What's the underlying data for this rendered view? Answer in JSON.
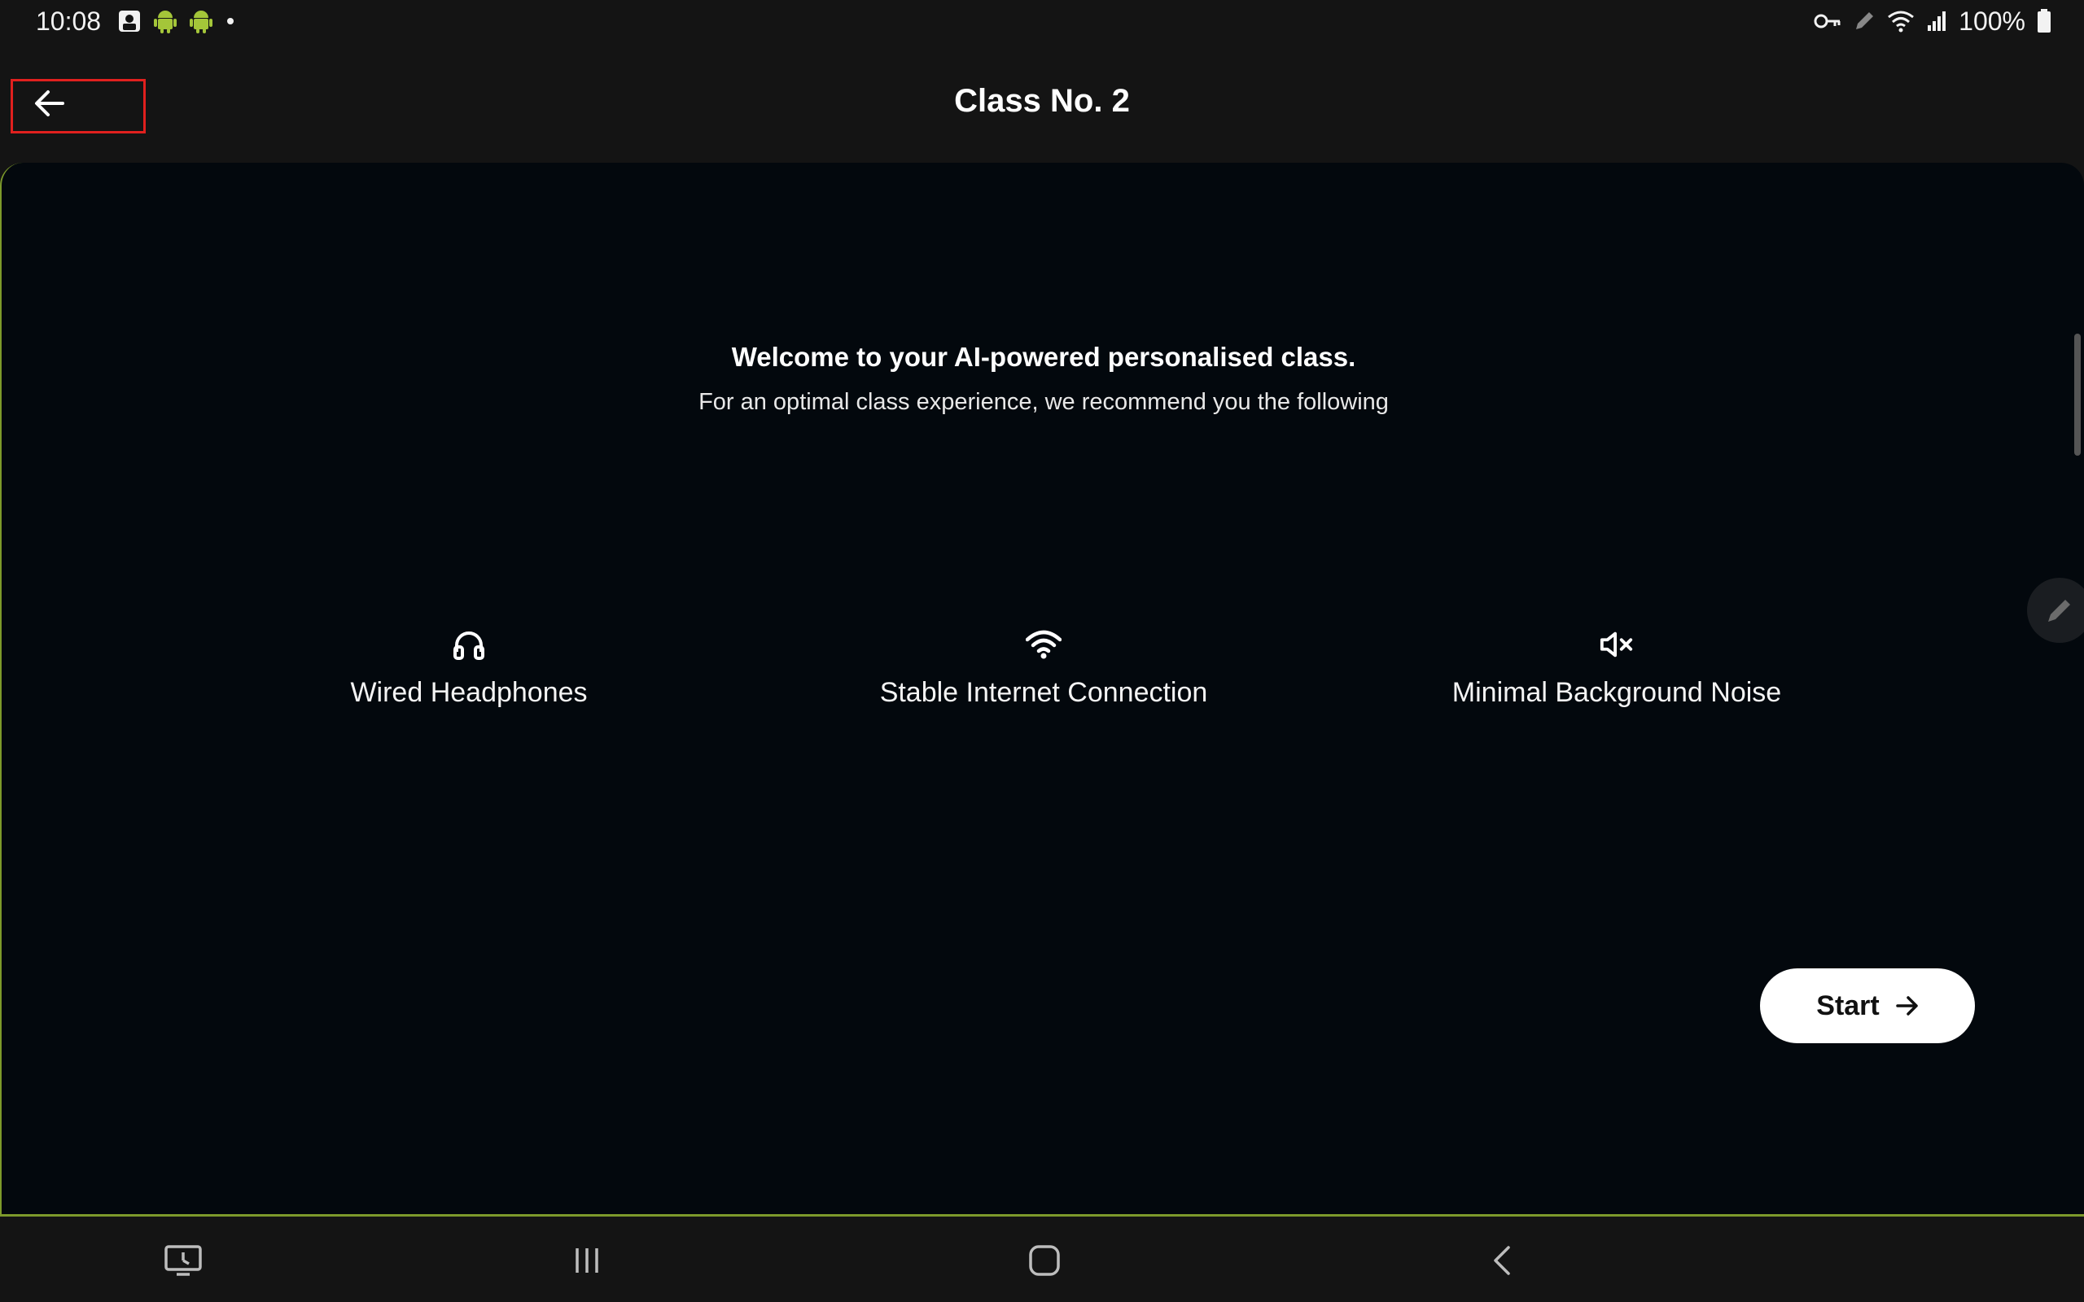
{
  "status_bar": {
    "time": "10:08",
    "battery_text": "100%",
    "left_icons": [
      "notification-icon",
      "android-icon",
      "android-icon",
      "dot-icon"
    ],
    "right_icons": [
      "key-icon",
      "pen-icon",
      "wifi-icon",
      "signal-icon",
      "battery-icon"
    ]
  },
  "app_bar": {
    "title": "Class No. 2",
    "back_icon": "arrow-left-icon"
  },
  "welcome": {
    "title": "Welcome to your AI-powered personalised class.",
    "subtitle": "For an optimal class experience, we recommend you the following"
  },
  "recommendations": [
    {
      "icon": "headphones-icon",
      "label": "Wired Headphones"
    },
    {
      "icon": "wifi-icon",
      "label": "Stable Internet Connection"
    },
    {
      "icon": "mute-icon",
      "label": "Minimal Background Noise"
    }
  ],
  "start_button": {
    "label": "Start",
    "icon": "arrow-right-icon"
  },
  "nav_bar": {
    "items": [
      "screen-share-icon",
      "recent-apps-icon",
      "home-icon",
      "back-icon"
    ]
  },
  "colors": {
    "background": "#141414",
    "card": "#03080d",
    "accent_border": "#7d9a2b",
    "android_green": "#a4c639",
    "highlight": "#e0201e",
    "button": "#ffffff"
  }
}
